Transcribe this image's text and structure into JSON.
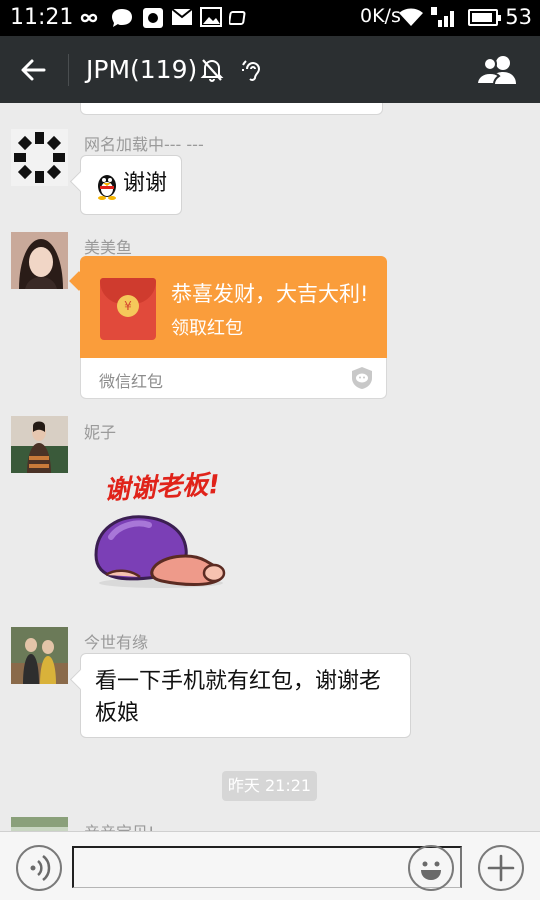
{
  "status_bar": {
    "time": "11:21",
    "network_speed": "0K/s",
    "battery": "53"
  },
  "title_bar": {
    "title": "JPM(119)"
  },
  "messages": [
    {
      "sender": "网名加载中--- ---",
      "text": "谢谢"
    },
    {
      "sender": "美美鱼",
      "red_packet": {
        "greeting": "恭喜发财，大吉大利!",
        "action": "领取红包",
        "footer": "微信红包"
      }
    },
    {
      "sender": "妮子",
      "sticker_caption": "谢谢老板!"
    },
    {
      "sender": "今世有缘",
      "text": "看一下手机就有红包，谢谢老板娘"
    },
    {
      "sender": "亲亲宝贝!"
    }
  ],
  "time_divider": "昨天 21:21",
  "colors": {
    "title_bar_bg": "#2b2f31",
    "chat_bg": "#ebebeb",
    "red_packet_orange": "#fa9d3b",
    "sticker_red": "#e0231a"
  }
}
